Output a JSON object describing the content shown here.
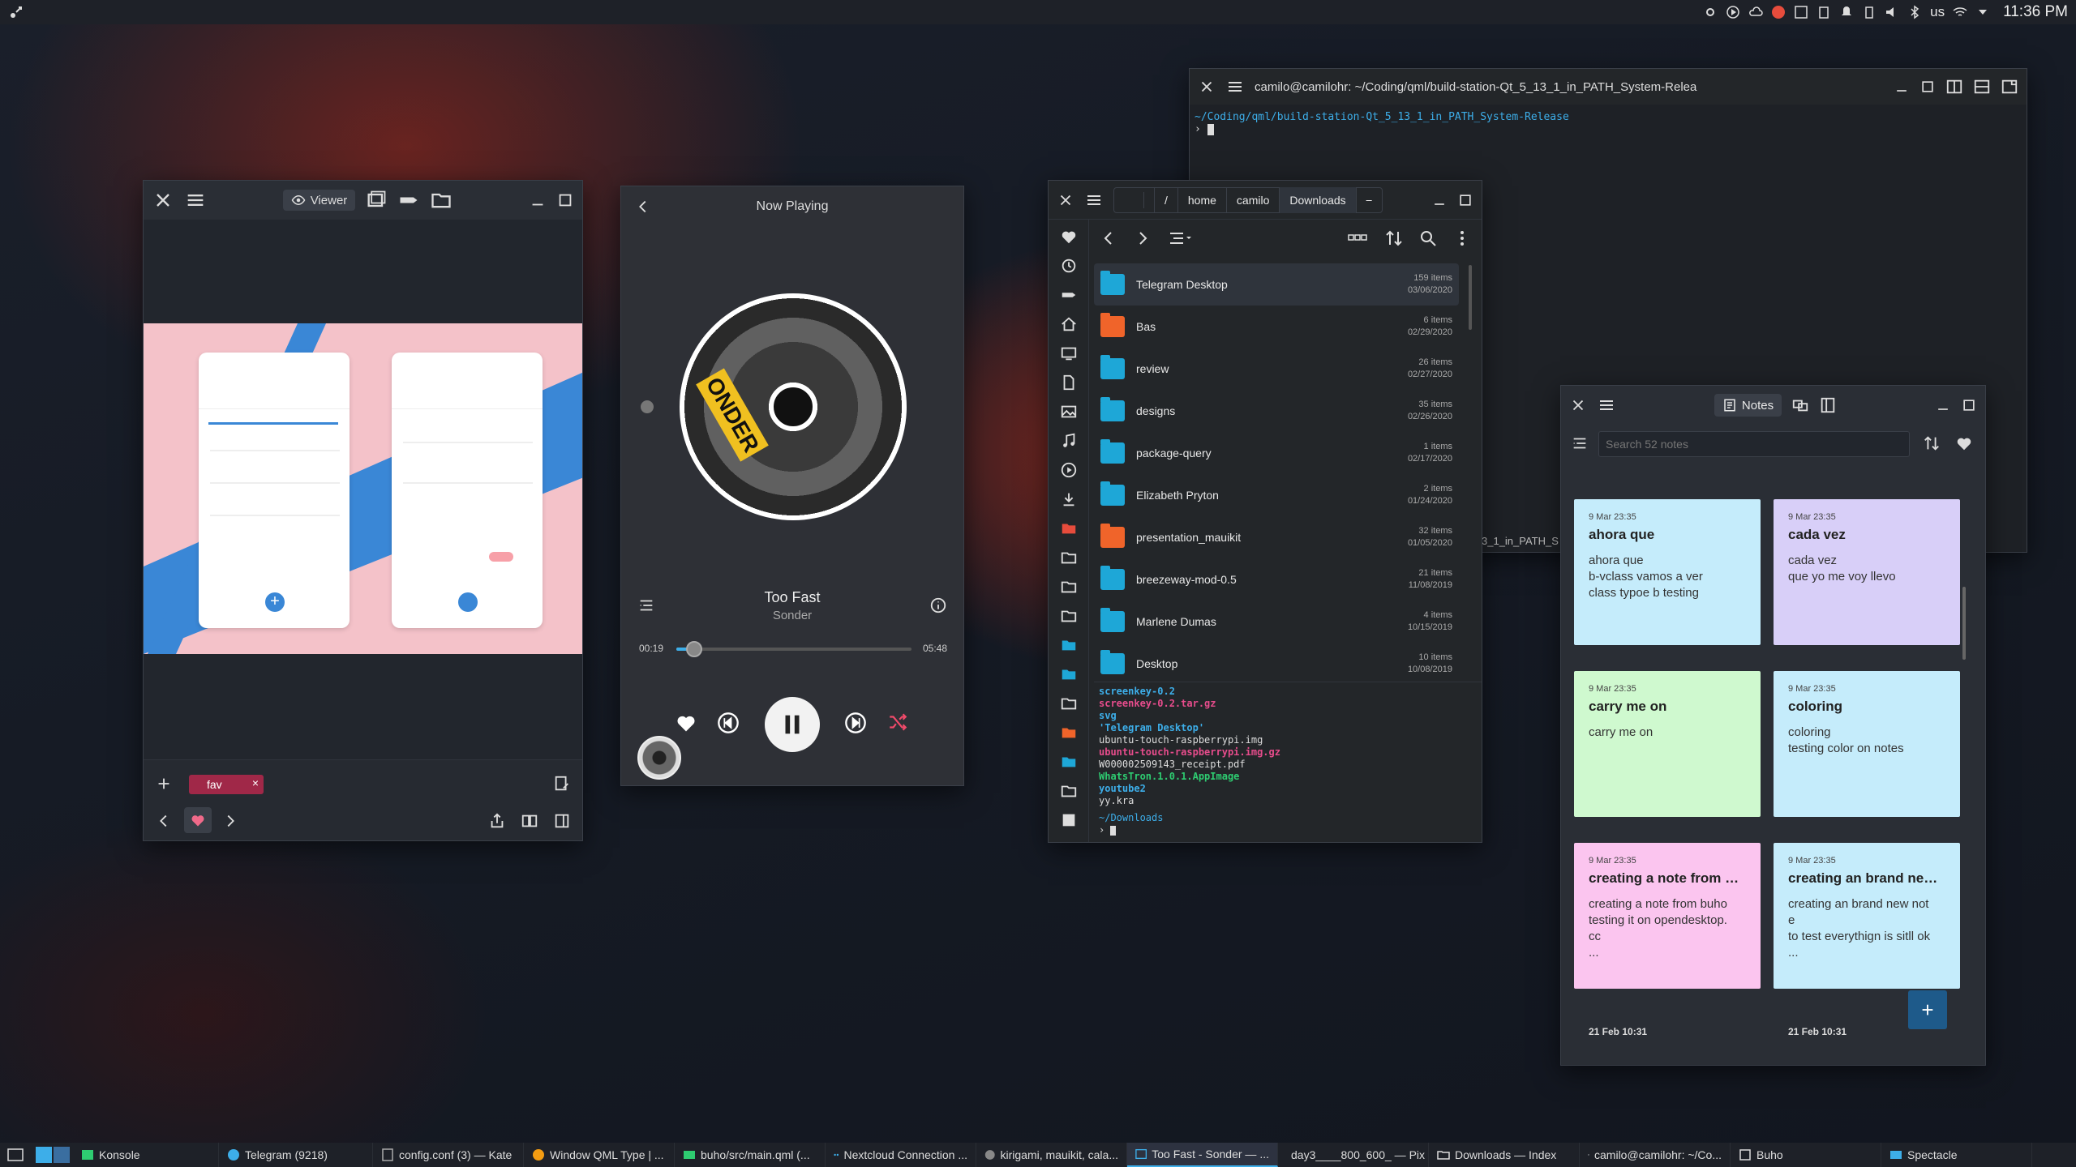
{
  "top_panel": {
    "clock": "11:36 PM",
    "keyboard_layout": "us"
  },
  "pix": {
    "viewer_label": "Viewer",
    "tag_label": "fav"
  },
  "vvave": {
    "header": "Now Playing",
    "track": "Too Fast",
    "artist": "Sonder",
    "elapsed": "00:19",
    "duration": "05:48",
    "progress": 0.05,
    "cover_text": "ONDER"
  },
  "index": {
    "breadcrumb": [
      "/",
      "home",
      "camilo",
      "Downloads"
    ],
    "files": [
      {
        "name": "Telegram Desktop",
        "items": "159 items",
        "date": "03/06/2020",
        "color": "#1ea7d7"
      },
      {
        "name": "Bas",
        "items": "6 items",
        "date": "02/29/2020",
        "color": "#f0642a"
      },
      {
        "name": "review",
        "items": "26 items",
        "date": "02/27/2020",
        "color": "#1ea7d7"
      },
      {
        "name": "designs",
        "items": "35 items",
        "date": "02/26/2020",
        "color": "#1ea7d7"
      },
      {
        "name": "package-query",
        "items": "1 items",
        "date": "02/17/2020",
        "color": "#1ea7d7"
      },
      {
        "name": "Elizabeth Pryton",
        "items": "2 items",
        "date": "01/24/2020",
        "color": "#1ea7d7"
      },
      {
        "name": "presentation_mauikit",
        "items": "32 items",
        "date": "01/05/2020",
        "color": "#f0642a"
      },
      {
        "name": "breezeway-mod-0.5",
        "items": "21 items",
        "date": "11/08/2019",
        "color": "#1ea7d7"
      },
      {
        "name": "Marlene Dumas",
        "items": "4 items",
        "date": "10/15/2019",
        "color": "#1ea7d7"
      },
      {
        "name": "Desktop",
        "items": "10 items",
        "date": "10/08/2019",
        "color": "#1ea7d7"
      }
    ],
    "terminal_lines": [
      {
        "text": "screenkey-0.2",
        "color": "#3daee9"
      },
      {
        "text": "screenkey-0.2.tar.gz",
        "color": "#e74c8c"
      },
      {
        "text": "svg",
        "color": "#3daee9"
      },
      {
        "text": "'Telegram Desktop'",
        "color": "#3daee9"
      },
      {
        "text": "ubuntu-touch-raspberrypi.img",
        "color": "#dddddd"
      },
      {
        "text": "ubuntu-touch-raspberrypi.img.gz",
        "color": "#e74c8c"
      },
      {
        "text": "W000002509143_receipt.pdf",
        "color": "#dddddd"
      },
      {
        "text": "WhatsTron.1.0.1.AppImage",
        "color": "#2ecc71"
      },
      {
        "text": "youtube2",
        "color": "#3daee9"
      },
      {
        "text": "yy.kra",
        "color": "#dddddd"
      }
    ],
    "terminal_prompt": "~/Downloads"
  },
  "konsole": {
    "title": "camilo@camilohr: ~/Coding/qml/build-station-Qt_5_13_1_in_PATH_System-Relea",
    "path_line": "~/Coding/qml/build-station-Qt_5_13_1_in_PATH_System-Release",
    "behind_text": "3_1_in_PATH_S"
  },
  "buho": {
    "notes_label": "Notes",
    "search_placeholder": "Search 52 notes",
    "notes": [
      {
        "date": "9 Mar 23:35",
        "title": "ahora que",
        "body": "ahora que\nb-vclass vamos a ver\nclass typoe b testing",
        "color": "#c5ecfb"
      },
      {
        "date": "9 Mar 23:35",
        "title": "cada vez",
        "body": "cada vez\nque yo me voy llevo",
        "color": "#d8cff8"
      },
      {
        "date": "9 Mar 23:35",
        "title": "carry me on",
        "body": "carry me on",
        "color": "#cff9cf"
      },
      {
        "date": "9 Mar 23:35",
        "title": "coloring",
        "body": "coloring\ntesting color on notes",
        "color": "#c5ecfb"
      },
      {
        "date": "9 Mar 23:35",
        "title": "creating a note from bu...",
        "body": "creating a note from buho\ntesting it on opendesktop.\ncc\n...",
        "color": "#fbc5ef"
      },
      {
        "date": "9 Mar 23:35",
        "title": "creating an brand new ...",
        "body": "creating an brand new not\ne\nto test everythign is sitll ok\n...",
        "color": "#c5ecfb"
      }
    ],
    "footer_dates": [
      "21 Feb 10:31",
      "21 Feb 10:31"
    ]
  },
  "taskbar": {
    "tasks": [
      {
        "label": "Konsole",
        "color": "#2ecc71"
      },
      {
        "label": "Telegram (9218)",
        "color": "#3daee9"
      },
      {
        "label": "config.conf (3) — Kate",
        "color": "#aaaaaa"
      },
      {
        "label": "Window QML Type | ...",
        "color": "#f39c12"
      },
      {
        "label": "buho/src/main.qml (...",
        "color": "#2ecc71"
      },
      {
        "label": "Nextcloud Connection ...",
        "color": "#3daee9"
      },
      {
        "label": "kirigami, mauikit, cala...",
        "color": "#888888"
      },
      {
        "label": "Too Fast - Sonder — ...",
        "color": "#3daee9"
      },
      {
        "label": "day3____800_600_ — Pix",
        "color": "#e74c3c"
      },
      {
        "label": "Downloads — Index",
        "color": "#dddddd"
      },
      {
        "label": "camilo@camilohr: ~/Co...",
        "color": "#dddddd"
      },
      {
        "label": "Buho",
        "color": "#dddddd"
      },
      {
        "label": "Spectacle",
        "color": "#3daee9"
      }
    ]
  }
}
